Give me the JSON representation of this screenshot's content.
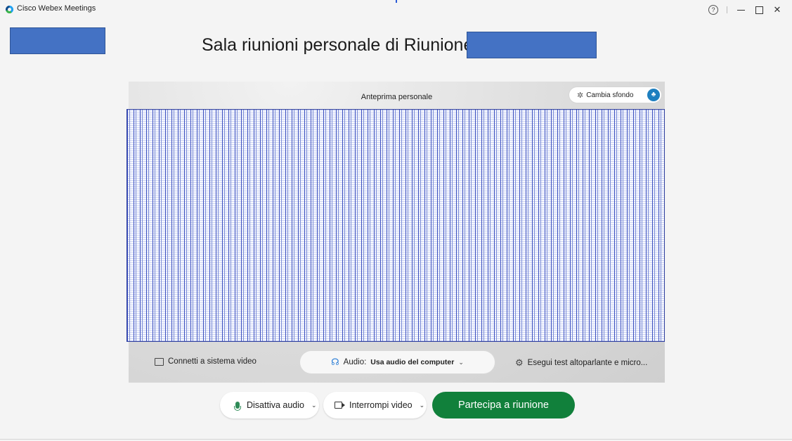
{
  "window": {
    "title": "Cisco Webex Meetings",
    "controls": {
      "help": "?",
      "minimize": "—",
      "maximize": "☐",
      "close": "✕"
    }
  },
  "room": {
    "title": "Sala riunioni personale di Riunione"
  },
  "preview": {
    "label": "Anteprima personale",
    "change_background_label": "Cambia sfondo"
  },
  "toolbar": {
    "connect_label": "Connetti a sistema video",
    "audio_prefix": "Audio:",
    "audio_value": "Usa audio del computer",
    "test_label": "Esegui test altoparlante e micro..."
  },
  "controls": {
    "mute_label": "Disattiva audio",
    "video_label": "Interrompi video",
    "join_label": "Partecipa a riunione"
  },
  "icons": {
    "app": "webex-logo-icon",
    "background": "magic-wand-icon",
    "tree": "tree-icon",
    "cast": "cast-icon",
    "audio": "headset-icon",
    "settings": "gear-icon",
    "mic": "microphone-icon",
    "camera": "video-camera-icon"
  },
  "colors": {
    "join_button": "#11803b",
    "redaction": "#4472c4",
    "accent": "#1e7fbf"
  }
}
